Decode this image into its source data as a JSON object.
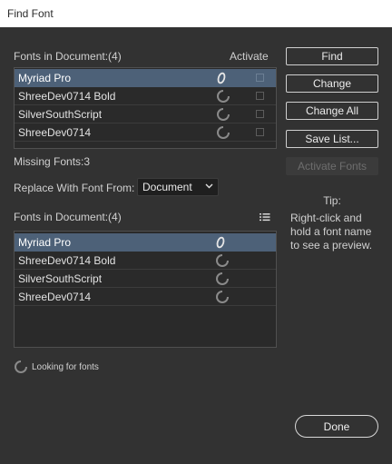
{
  "window": {
    "title": "Find Font"
  },
  "top_section": {
    "heading": "Fonts in Document:(4)",
    "activate_header": "Activate",
    "fonts": [
      {
        "name": "Myriad Pro",
        "status_icon": "opentype-font-icon",
        "selected": true
      },
      {
        "name": "ShreeDev0714 Bold",
        "status_icon": "loading-spinner-icon",
        "selected": false
      },
      {
        "name": "SilverSouthScript",
        "status_icon": "loading-spinner-icon",
        "selected": false
      },
      {
        "name": "ShreeDev0714",
        "status_icon": "loading-spinner-icon",
        "selected": false
      }
    ]
  },
  "missing_fonts": "Missing Fonts:3",
  "replace": {
    "label": "Replace With Font From:",
    "selected": "Document"
  },
  "bottom_section": {
    "heading": "Fonts in Document:(4)",
    "fonts": [
      {
        "name": "Myriad Pro",
        "status_icon": "opentype-font-icon",
        "selected": true
      },
      {
        "name": "ShreeDev0714 Bold",
        "status_icon": "loading-spinner-icon",
        "selected": false
      },
      {
        "name": "SilverSouthScript",
        "status_icon": "loading-spinner-icon",
        "selected": false
      },
      {
        "name": "ShreeDev0714",
        "status_icon": "loading-spinner-icon",
        "selected": false
      }
    ]
  },
  "buttons": {
    "find": "Find",
    "change": "Change",
    "change_all": "Change All",
    "save_list": "Save List...",
    "activate_fonts": "Activate Fonts",
    "done": "Done"
  },
  "tip": {
    "title": "Tip:",
    "text": "Right-click and hold a font name to see a preview."
  },
  "status": {
    "looking": "Looking for fonts"
  },
  "colors": {
    "background": "#323232",
    "list_background": "#2a2a2a",
    "selection": "#4d6178",
    "title_bar": "#ffffff"
  }
}
